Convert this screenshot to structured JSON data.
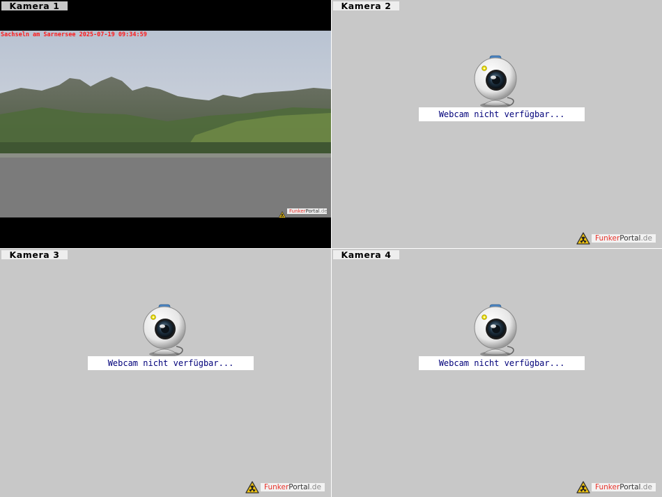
{
  "cameras": [
    {
      "label": "Kamera 1",
      "overlay": "Sachseln am Sarnersee 2025-07-19 09:34:59",
      "logo": {
        "part1": "Funk",
        "part2": "er",
        "part3": "Portal",
        "part4": ".de"
      }
    },
    {
      "label": "Kamera 2",
      "status": "Webcam nicht verfügbar...",
      "logo": {
        "part1": "Funk",
        "part2": "er",
        "part3": "Portal",
        "part4": ".de"
      }
    },
    {
      "label": "Kamera 3",
      "status": "Webcam nicht verfügbar...",
      "logo": {
        "part1": "Funk",
        "part2": "er",
        "part3": "Portal",
        "part4": ".de"
      }
    },
    {
      "label": "Kamera 4",
      "status": "Webcam nicht verfügbar...",
      "logo": {
        "part1": "Funk",
        "part2": "er",
        "part3": "Portal",
        "part4": ".de"
      }
    }
  ],
  "icons": {
    "webcam": "webcam-icon",
    "logo": "radiation-warning-icon"
  },
  "colors": {
    "overlay_text": "#ff1a1a",
    "status_text": "#00007a",
    "panel_background": "#c8c8c8",
    "logo_red": "#e8322a"
  }
}
